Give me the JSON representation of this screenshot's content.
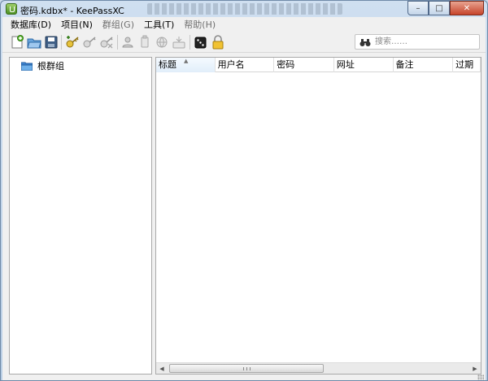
{
  "window": {
    "title": "密码.kdbx* - KeePassXC",
    "controls": {
      "minimize": "–",
      "maximize": "□",
      "close": "✕"
    }
  },
  "menu": {
    "items": [
      "数据库(D)",
      "项目(N)",
      "群组(G)",
      "工具(T)",
      "帮助(H)"
    ]
  },
  "toolbar": {
    "icons": [
      "new-database-icon",
      "open-database-icon",
      "save-database-icon",
      "add-entry-icon",
      "edit-entry-icon",
      "delete-entry-icon",
      "copy-username-icon",
      "copy-password-icon",
      "copy-url-icon",
      "autotype-icon",
      "password-generator-icon",
      "lock-database-icon"
    ]
  },
  "search": {
    "placeholder": "搜索……"
  },
  "groups": {
    "root": "根群组"
  },
  "entries": {
    "columns": [
      "标题",
      "用户名",
      "密码",
      "网址",
      "备注",
      "过期"
    ],
    "sorted_column": "标题"
  },
  "colors": {
    "titlebar": "#c9d9ea",
    "close_button": "#c7442a",
    "folder": "#3f86d4",
    "sorted_header": "#e1eefa"
  }
}
